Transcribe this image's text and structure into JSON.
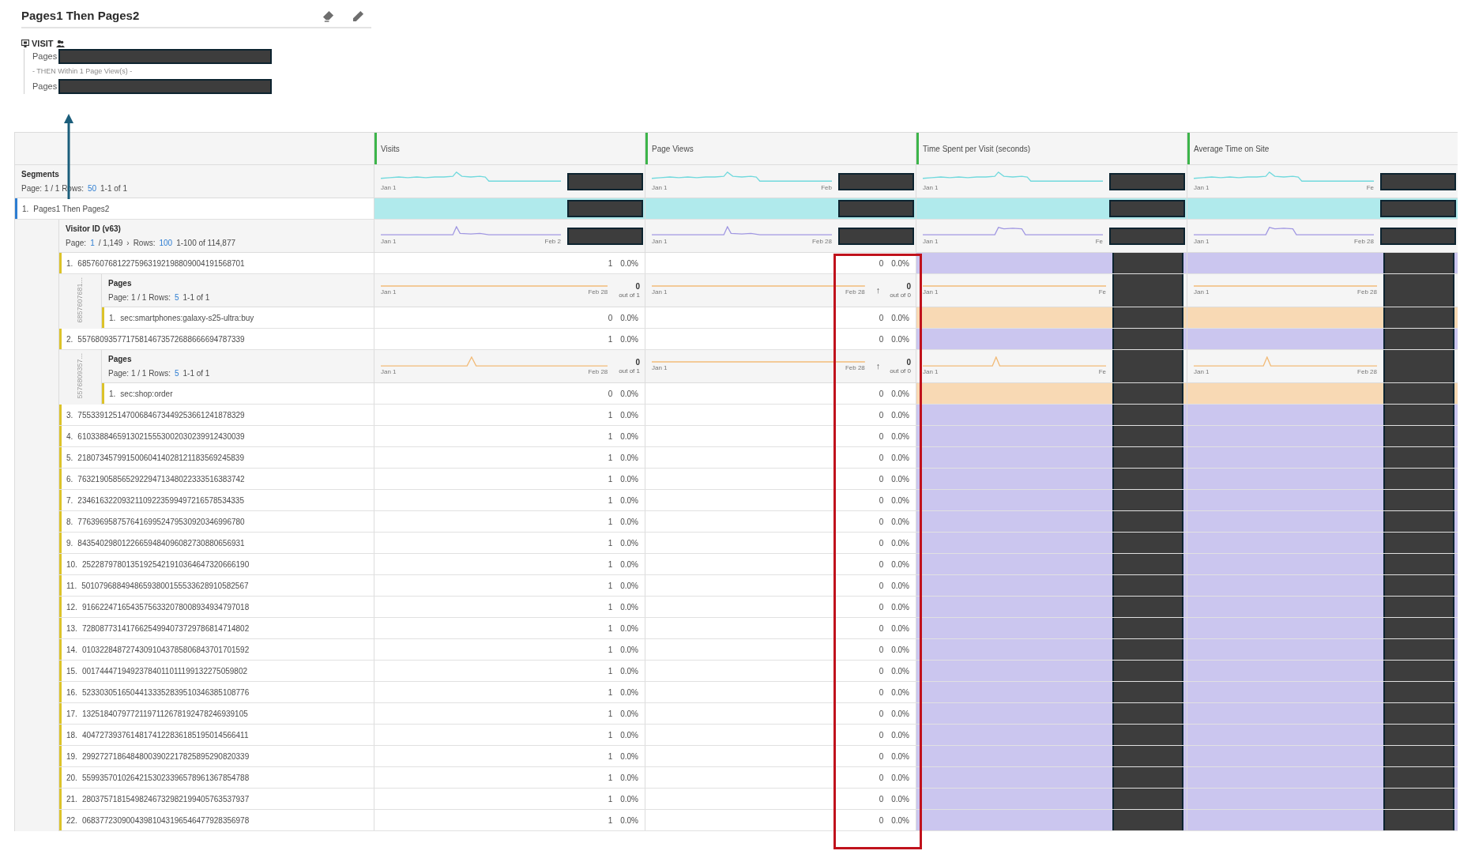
{
  "panel": {
    "title": "Pages1 Then Pages2"
  },
  "segment_definition": {
    "container": "VISIT",
    "lines": [
      {
        "kind": "rule",
        "text": "Pages",
        "redacted": true
      },
      {
        "kind": "connector",
        "text": "- THEN Within 1 Page View(s) -"
      },
      {
        "kind": "rule",
        "text": "Pages",
        "redacted": true
      }
    ]
  },
  "table": {
    "columns": [
      {
        "title": "Visits"
      },
      {
        "title": "Page Views"
      },
      {
        "title": "Time Spent per Visit (seconds)"
      },
      {
        "title": "Average Time on Site"
      }
    ],
    "segments": {
      "title": "Segments",
      "color": "#b0eaec",
      "pager": [
        {
          "kind": "text",
          "text": "Page: 1 / 1 Rows:"
        },
        {
          "kind": "link",
          "text": "50"
        },
        {
          "kind": "text",
          "text": "1-1 of 1"
        }
      ],
      "cells": [
        {
          "kind": "spark",
          "start": "Jan 1",
          "redacted": true
        },
        {
          "kind": "spark",
          "start": "Jan 1",
          "end": "Feb",
          "redacted": true
        },
        {
          "kind": "spark",
          "start": "Jan 1",
          "redacted": true
        },
        {
          "kind": "spark",
          "start": "Jan 1",
          "end": "Fe",
          "redacted": true
        }
      ],
      "rows": [
        {
          "number": "1.",
          "label": "Pages1 Then Pages2",
          "cells": [
            {
              "kind": "bar",
              "redacted": true
            },
            {
              "kind": "bar",
              "redacted": true
            },
            {
              "kind": "bar",
              "redacted": true
            },
            {
              "kind": "bar",
              "redacted": true
            }
          ],
          "breakdown": {
            "title": "Visitor ID (v63)",
            "color": "#cbc6ef",
            "pager": [
              {
                "kind": "text",
                "text": "Page:"
              },
              {
                "kind": "link",
                "text": "1"
              },
              {
                "kind": "text",
                "text": "/ 1,149"
              },
              {
                "kind": "button",
                "text": "›"
              },
              {
                "kind": "text",
                "text": "Rows:"
              },
              {
                "kind": "link",
                "text": "100"
              },
              {
                "kind": "text",
                "text": "1-100 of 114,877"
              }
            ],
            "cells": [
              {
                "kind": "spark",
                "start": "Jan 1",
                "end": "Feb 2",
                "redacted": true
              },
              {
                "kind": "spark",
                "start": "Jan 1",
                "end": "Feb 28",
                "redacted": true
              },
              {
                "kind": "spark",
                "start": "Jan 1",
                "end": "Fe",
                "redacted": true
              },
              {
                "kind": "spark",
                "start": "Jan 1",
                "end": "Feb 28",
                "redacted": true
              }
            ],
            "rows": [
              {
                "number": "1.",
                "label": "68576076812275963192198809004191568701",
                "cells": [
                  {
                    "kind": "values",
                    "value": "1",
                    "percent": "0.0%"
                  },
                  {
                    "kind": "values",
                    "value": "0",
                    "percent": "0.0%"
                  },
                  {
                    "kind": "bar",
                    "redacted": true
                  },
                  {
                    "kind": "bar",
                    "redacted": true
                  }
                ],
                "breakdown": {
                  "side_label": "6857607681...",
                  "title": "Pages",
                  "color": "#f8d9b4",
                  "pager": [
                    {
                      "kind": "text",
                      "text": "Page: 1 / 1 Rows:"
                    },
                    {
                      "kind": "link",
                      "text": "5"
                    },
                    {
                      "kind": "text",
                      "text": "1-1 of 1"
                    }
                  ],
                  "cells": [
                    {
                      "kind": "spark",
                      "start": "Jan 1",
                      "end": "Feb 28",
                      "total": "0",
                      "total_note": "out of 1"
                    },
                    {
                      "kind": "spark",
                      "start": "Jan 1",
                      "end": "Feb 28",
                      "arrow": "↑",
                      "total": "0",
                      "total_note": "out of 0"
                    },
                    {
                      "kind": "spark",
                      "start": "Jan 1",
                      "end": "Fe",
                      "redacted": true
                    },
                    {
                      "kind": "spark",
                      "start": "Jan 1",
                      "end": "Feb 28",
                      "redacted": true
                    }
                  ],
                  "rows": [
                    {
                      "number": "1.",
                      "label": "sec:smartphones:galaxy-s25-ultra:buy",
                      "cells": [
                        {
                          "kind": "values",
                          "value": "0",
                          "percent": "0.0%"
                        },
                        {
                          "kind": "values",
                          "value": "0",
                          "percent": "0.0%"
                        },
                        {
                          "kind": "bar",
                          "redacted": true
                        },
                        {
                          "kind": "bar",
                          "redacted": true
                        }
                      ]
                    }
                  ]
                }
              },
              {
                "number": "2.",
                "label": "55768093577175814673572688666694787339",
                "cells": [
                  {
                    "kind": "values",
                    "value": "1",
                    "percent": "0.0%"
                  },
                  {
                    "kind": "values",
                    "value": "0",
                    "percent": "0.0%"
                  },
                  {
                    "kind": "bar",
                    "redacted": true
                  },
                  {
                    "kind": "bar",
                    "redacted": true
                  }
                ],
                "breakdown": {
                  "side_label": "5576809357...",
                  "title": "Pages",
                  "color": "#f8d9b4",
                  "pager": [
                    {
                      "kind": "text",
                      "text": "Page: 1 / 1 Rows:"
                    },
                    {
                      "kind": "link",
                      "text": "5"
                    },
                    {
                      "kind": "text",
                      "text": "1-1 of 1"
                    }
                  ],
                  "cells": [
                    {
                      "kind": "spark",
                      "start": "Jan 1",
                      "end": "Feb 28",
                      "total": "0",
                      "total_note": "out of 1"
                    },
                    {
                      "kind": "spark",
                      "start": "Jan 1",
                      "end": "Feb 28",
                      "arrow": "↑",
                      "total": "0",
                      "total_note": "out of 0"
                    },
                    {
                      "kind": "spark",
                      "start": "Jan 1",
                      "end": "Fe",
                      "redacted": true
                    },
                    {
                      "kind": "spark",
                      "start": "Jan 1",
                      "end": "Feb 28",
                      "redacted": true
                    }
                  ],
                  "rows": [
                    {
                      "number": "1.",
                      "label": "sec:shop:order",
                      "cells": [
                        {
                          "kind": "values",
                          "value": "0",
                          "percent": "0.0%"
                        },
                        {
                          "kind": "values",
                          "value": "0",
                          "percent": "0.0%"
                        },
                        {
                          "kind": "bar",
                          "redacted": true
                        },
                        {
                          "kind": "bar",
                          "redacted": true
                        }
                      ]
                    }
                  ]
                }
              },
              {
                "number": "3.",
                "label": "75533912514700684673449253661241878329",
                "cells": [
                  {
                    "kind": "values",
                    "value": "1",
                    "percent": "0.0%"
                  },
                  {
                    "kind": "values",
                    "value": "0",
                    "percent": "0.0%"
                  },
                  {
                    "kind": "bar",
                    "redacted": true
                  },
                  {
                    "kind": "bar",
                    "redacted": true
                  }
                ]
              },
              {
                "number": "4.",
                "label": "61033884659130215553002030239912430039",
                "cells": [
                  {
                    "kind": "values",
                    "value": "1",
                    "percent": "0.0%"
                  },
                  {
                    "kind": "values",
                    "value": "0",
                    "percent": "0.0%"
                  },
                  {
                    "kind": "bar",
                    "redacted": true
                  },
                  {
                    "kind": "bar",
                    "redacted": true
                  }
                ]
              },
              {
                "number": "5.",
                "label": "21807345799150060414028121183569245839",
                "cells": [
                  {
                    "kind": "values",
                    "value": "1",
                    "percent": "0.0%"
                  },
                  {
                    "kind": "values",
                    "value": "0",
                    "percent": "0.0%"
                  },
                  {
                    "kind": "bar",
                    "redacted": true
                  },
                  {
                    "kind": "bar",
                    "redacted": true
                  }
                ]
              },
              {
                "number": "6.",
                "label": "76321905856529229471348022333516383742",
                "cells": [
                  {
                    "kind": "values",
                    "value": "1",
                    "percent": "0.0%"
                  },
                  {
                    "kind": "values",
                    "value": "0",
                    "percent": "0.0%"
                  },
                  {
                    "kind": "bar",
                    "redacted": true
                  },
                  {
                    "kind": "bar",
                    "redacted": true
                  }
                ]
              },
              {
                "number": "7.",
                "label": "23461632209321109223599497216578534335",
                "cells": [
                  {
                    "kind": "values",
                    "value": "1",
                    "percent": "0.0%"
                  },
                  {
                    "kind": "values",
                    "value": "0",
                    "percent": "0.0%"
                  },
                  {
                    "kind": "bar",
                    "redacted": true
                  },
                  {
                    "kind": "bar",
                    "redacted": true
                  }
                ]
              },
              {
                "number": "8.",
                "label": "77639695875764169952479530920346996780",
                "cells": [
                  {
                    "kind": "values",
                    "value": "1",
                    "percent": "0.0%"
                  },
                  {
                    "kind": "values",
                    "value": "0",
                    "percent": "0.0%"
                  },
                  {
                    "kind": "bar",
                    "redacted": true
                  },
                  {
                    "kind": "bar",
                    "redacted": true
                  }
                ]
              },
              {
                "number": "9.",
                "label": "84354029801226659484096082730880656931",
                "cells": [
                  {
                    "kind": "values",
                    "value": "1",
                    "percent": "0.0%"
                  },
                  {
                    "kind": "values",
                    "value": "0",
                    "percent": "0.0%"
                  },
                  {
                    "kind": "bar",
                    "redacted": true
                  },
                  {
                    "kind": "bar",
                    "redacted": true
                  }
                ]
              },
              {
                "number": "10.",
                "label": "25228797801351925421910364647320666190",
                "cells": [
                  {
                    "kind": "values",
                    "value": "1",
                    "percent": "0.0%"
                  },
                  {
                    "kind": "values",
                    "value": "0",
                    "percent": "0.0%"
                  },
                  {
                    "kind": "bar",
                    "redacted": true
                  },
                  {
                    "kind": "bar",
                    "redacted": true
                  }
                ]
              },
              {
                "number": "11.",
                "label": "50107968849486593800155533628910582567",
                "cells": [
                  {
                    "kind": "values",
                    "value": "1",
                    "percent": "0.0%"
                  },
                  {
                    "kind": "values",
                    "value": "0",
                    "percent": "0.0%"
                  },
                  {
                    "kind": "bar",
                    "redacted": true
                  },
                  {
                    "kind": "bar",
                    "redacted": true
                  }
                ]
              },
              {
                "number": "12.",
                "label": "91662247165435756332078008934934797018",
                "cells": [
                  {
                    "kind": "values",
                    "value": "1",
                    "percent": "0.0%"
                  },
                  {
                    "kind": "values",
                    "value": "0",
                    "percent": "0.0%"
                  },
                  {
                    "kind": "bar",
                    "redacted": true
                  },
                  {
                    "kind": "bar",
                    "redacted": true
                  }
                ]
              },
              {
                "number": "13.",
                "label": "72808773141766254994073729786814714802",
                "cells": [
                  {
                    "kind": "values",
                    "value": "1",
                    "percent": "0.0%"
                  },
                  {
                    "kind": "values",
                    "value": "0",
                    "percent": "0.0%"
                  },
                  {
                    "kind": "bar",
                    "redacted": true
                  },
                  {
                    "kind": "bar",
                    "redacted": true
                  }
                ]
              },
              {
                "number": "14.",
                "label": "01032284872743091043785806843701701592",
                "cells": [
                  {
                    "kind": "values",
                    "value": "1",
                    "percent": "0.0%"
                  },
                  {
                    "kind": "values",
                    "value": "0",
                    "percent": "0.0%"
                  },
                  {
                    "kind": "bar",
                    "redacted": true
                  },
                  {
                    "kind": "bar",
                    "redacted": true
                  }
                ]
              },
              {
                "number": "15.",
                "label": "00174447194923784011011199132275059802",
                "cells": [
                  {
                    "kind": "values",
                    "value": "1",
                    "percent": "0.0%"
                  },
                  {
                    "kind": "values",
                    "value": "0",
                    "percent": "0.0%"
                  },
                  {
                    "kind": "bar",
                    "redacted": true
                  },
                  {
                    "kind": "bar",
                    "redacted": true
                  }
                ]
              },
              {
                "number": "16.",
                "label": "52330305165044133352839510346385108776",
                "cells": [
                  {
                    "kind": "values",
                    "value": "1",
                    "percent": "0.0%"
                  },
                  {
                    "kind": "values",
                    "value": "0",
                    "percent": "0.0%"
                  },
                  {
                    "kind": "bar",
                    "redacted": true
                  },
                  {
                    "kind": "bar",
                    "redacted": true
                  }
                ]
              },
              {
                "number": "17.",
                "label": "13251840797721197112678192478246939105",
                "cells": [
                  {
                    "kind": "values",
                    "value": "1",
                    "percent": "0.0%"
                  },
                  {
                    "kind": "values",
                    "value": "0",
                    "percent": "0.0%"
                  },
                  {
                    "kind": "bar",
                    "redacted": true
                  },
                  {
                    "kind": "bar",
                    "redacted": true
                  }
                ]
              },
              {
                "number": "18.",
                "label": "40472739376148174122836185195014566411",
                "cells": [
                  {
                    "kind": "values",
                    "value": "1",
                    "percent": "0.0%"
                  },
                  {
                    "kind": "values",
                    "value": "0",
                    "percent": "0.0%"
                  },
                  {
                    "kind": "bar",
                    "redacted": true
                  },
                  {
                    "kind": "bar",
                    "redacted": true
                  }
                ]
              },
              {
                "number": "19.",
                "label": "29927271864848003902217825895290820339",
                "cells": [
                  {
                    "kind": "values",
                    "value": "1",
                    "percent": "0.0%"
                  },
                  {
                    "kind": "values",
                    "value": "0",
                    "percent": "0.0%"
                  },
                  {
                    "kind": "bar",
                    "redacted": true
                  },
                  {
                    "kind": "bar",
                    "redacted": true
                  }
                ]
              },
              {
                "number": "20.",
                "label": "55993570102642153023396578961367854788",
                "cells": [
                  {
                    "kind": "values",
                    "value": "1",
                    "percent": "0.0%"
                  },
                  {
                    "kind": "values",
                    "value": "0",
                    "percent": "0.0%"
                  },
                  {
                    "kind": "bar",
                    "redacted": true
                  },
                  {
                    "kind": "bar",
                    "redacted": true
                  }
                ]
              },
              {
                "number": "21.",
                "label": "28037571815498246732982199405763537937",
                "cells": [
                  {
                    "kind": "values",
                    "value": "1",
                    "percent": "0.0%"
                  },
                  {
                    "kind": "values",
                    "value": "0",
                    "percent": "0.0%"
                  },
                  {
                    "kind": "bar",
                    "redacted": true
                  },
                  {
                    "kind": "bar",
                    "redacted": true
                  }
                ]
              },
              {
                "number": "22.",
                "label": "06837723090043981043196546477928356978",
                "cells": [
                  {
                    "kind": "values",
                    "value": "1",
                    "percent": "0.0%"
                  },
                  {
                    "kind": "values",
                    "value": "0",
                    "percent": "0.0%"
                  },
                  {
                    "kind": "bar",
                    "redacted": true
                  },
                  {
                    "kind": "bar",
                    "redacted": true
                  }
                ]
              }
            ]
          }
        }
      ]
    }
  }
}
